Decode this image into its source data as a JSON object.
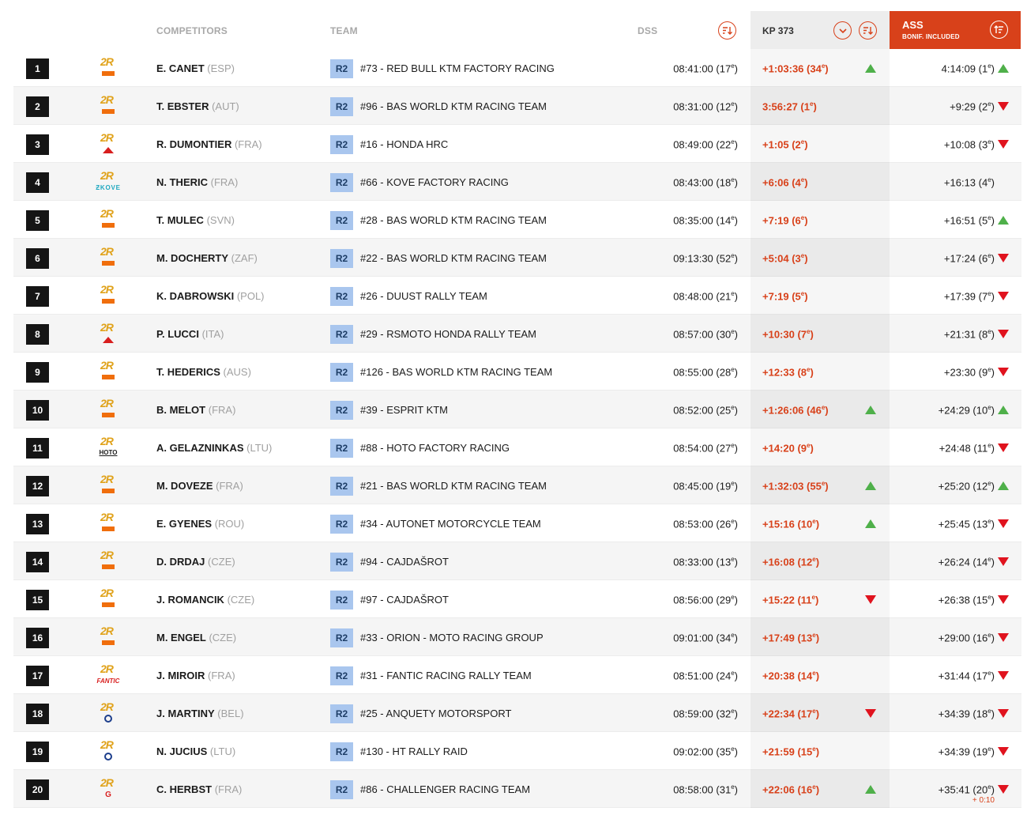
{
  "header": {
    "competitors": "COMPETITORS",
    "team": "TEAM",
    "dss": "DSS",
    "kp": "KP 373",
    "ass": "ASS",
    "ass_sub": "BONIF. INCLUDED"
  },
  "logo_text": "2R",
  "colors": {
    "accent": "#d8411a",
    "up": "#4fb04a",
    "down": "#e0131e",
    "category": "#a9c6ee"
  },
  "rows": [
    {
      "pos": "1",
      "brand": "ktm",
      "name": "E. CANET",
      "nat": "(ESP)",
      "cat": "R2",
      "team": "#73 - RED BULL KTM FACTORY RACING",
      "dss": "08:41:00 (17",
      "dss_rank": "e",
      "dss_end": ")",
      "kp": "+1:03:36 (34",
      "kp_rank": "e",
      "kp_end": ")",
      "kp_trend": "up",
      "ass": "4:14:09 (1",
      "ass_rank": "e",
      "ass_end": ")",
      "ass_trend": "up"
    },
    {
      "pos": "2",
      "brand": "ktm",
      "name": "T. EBSTER",
      "nat": "(AUT)",
      "cat": "R2",
      "team": "#96 - BAS WORLD KTM RACING TEAM",
      "dss": "08:31:00 (12",
      "dss_rank": "e",
      "dss_end": ")",
      "kp": "3:56:27 (1",
      "kp_rank": "e",
      "kp_end": ")",
      "kp_trend": "",
      "ass": "+9:29 (2",
      "ass_rank": "e",
      "ass_end": ")",
      "ass_trend": "down"
    },
    {
      "pos": "3",
      "brand": "honda",
      "name": "R. DUMONTIER",
      "nat": "(FRA)",
      "cat": "R2",
      "team": "#16 - HONDA HRC",
      "dss": "08:49:00 (22",
      "dss_rank": "e",
      "dss_end": ")",
      "kp": "+1:05 (2",
      "kp_rank": "e",
      "kp_end": ")",
      "kp_trend": "",
      "ass": "+10:08 (3",
      "ass_rank": "e",
      "ass_end": ")",
      "ass_trend": "down"
    },
    {
      "pos": "4",
      "brand": "kove",
      "name": "N. THERIC",
      "nat": "(FRA)",
      "cat": "R2",
      "team": "#66 - KOVE FACTORY RACING",
      "dss": "08:43:00 (18",
      "dss_rank": "e",
      "dss_end": ")",
      "kp": "+6:06 (4",
      "kp_rank": "e",
      "kp_end": ")",
      "kp_trend": "",
      "ass": "+16:13 (4",
      "ass_rank": "e",
      "ass_end": ")",
      "ass_trend": ""
    },
    {
      "pos": "5",
      "brand": "ktm",
      "name": "T. MULEC",
      "nat": "(SVN)",
      "cat": "R2",
      "team": "#28 - BAS WORLD KTM RACING TEAM",
      "dss": "08:35:00 (14",
      "dss_rank": "e",
      "dss_end": ")",
      "kp": "+7:19 (6",
      "kp_rank": "e",
      "kp_end": ")",
      "kp_trend": "",
      "ass": "+16:51 (5",
      "ass_rank": "e",
      "ass_end": ")",
      "ass_trend": "up"
    },
    {
      "pos": "6",
      "brand": "ktm",
      "name": "M. DOCHERTY",
      "nat": "(ZAF)",
      "cat": "R2",
      "team": "#22 - BAS WORLD KTM RACING TEAM",
      "dss": "09:13:30 (52",
      "dss_rank": "e",
      "dss_end": ")",
      "kp": "+5:04 (3",
      "kp_rank": "e",
      "kp_end": ")",
      "kp_trend": "",
      "ass": "+17:24 (6",
      "ass_rank": "e",
      "ass_end": ")",
      "ass_trend": "down"
    },
    {
      "pos": "7",
      "brand": "ktm",
      "name": "K. DABROWSKI",
      "nat": "(POL)",
      "cat": "R2",
      "team": "#26 - DUUST RALLY TEAM",
      "dss": "08:48:00 (21",
      "dss_rank": "e",
      "dss_end": ")",
      "kp": "+7:19 (5",
      "kp_rank": "e",
      "kp_end": ")",
      "kp_trend": "",
      "ass": "+17:39 (7",
      "ass_rank": "e",
      "ass_end": ")",
      "ass_trend": "down"
    },
    {
      "pos": "8",
      "brand": "honda",
      "name": "P. LUCCI",
      "nat": "(ITA)",
      "cat": "R2",
      "team": "#29 - RSMOTO HONDA RALLY TEAM",
      "dss": "08:57:00 (30",
      "dss_rank": "e",
      "dss_end": ")",
      "kp": "+10:30 (7",
      "kp_rank": "e",
      "kp_end": ")",
      "kp_trend": "",
      "ass": "+21:31 (8",
      "ass_rank": "e",
      "ass_end": ")",
      "ass_trend": "down"
    },
    {
      "pos": "9",
      "brand": "ktm",
      "name": "T. HEDERICS",
      "nat": "(AUS)",
      "cat": "R2",
      "team": "#126 - BAS WORLD KTM RACING TEAM",
      "dss": "08:55:00 (28",
      "dss_rank": "e",
      "dss_end": ")",
      "kp": "+12:33 (8",
      "kp_rank": "e",
      "kp_end": ")",
      "kp_trend": "",
      "ass": "+23:30 (9",
      "ass_rank": "e",
      "ass_end": ")",
      "ass_trend": "down"
    },
    {
      "pos": "10",
      "brand": "ktm",
      "name": "B. MELOT",
      "nat": "(FRA)",
      "cat": "R2",
      "team": "#39 - ESPRIT KTM",
      "dss": "08:52:00 (25",
      "dss_rank": "e",
      "dss_end": ")",
      "kp": "+1:26:06 (46",
      "kp_rank": "e",
      "kp_end": ")",
      "kp_trend": "up",
      "ass": "+24:29 (10",
      "ass_rank": "e",
      "ass_end": ")",
      "ass_trend": "up"
    },
    {
      "pos": "11",
      "brand": "hoto",
      "name": "A. GELAZNINKAS",
      "nat": "(LTU)",
      "cat": "R2",
      "team": "#88 - HOTO FACTORY RACING",
      "dss": "08:54:00 (27",
      "dss_rank": "e",
      "dss_end": ")",
      "kp": "+14:20 (9",
      "kp_rank": "e",
      "kp_end": ")",
      "kp_trend": "",
      "ass": "+24:48 (11",
      "ass_rank": "e",
      "ass_end": ")",
      "ass_trend": "down"
    },
    {
      "pos": "12",
      "brand": "ktm",
      "name": "M. DOVEZE",
      "nat": "(FRA)",
      "cat": "R2",
      "team": "#21 - BAS WORLD KTM RACING TEAM",
      "dss": "08:45:00 (19",
      "dss_rank": "e",
      "dss_end": ")",
      "kp": "+1:32:03 (55",
      "kp_rank": "e",
      "kp_end": ")",
      "kp_trend": "up",
      "ass": "+25:20 (12",
      "ass_rank": "e",
      "ass_end": ")",
      "ass_trend": "up"
    },
    {
      "pos": "13",
      "brand": "ktm",
      "name": "E. GYENES",
      "nat": "(ROU)",
      "cat": "R2",
      "team": "#34 - AUTONET MOTORCYCLE TEAM",
      "dss": "08:53:00 (26",
      "dss_rank": "e",
      "dss_end": ")",
      "kp": "+15:16 (10",
      "kp_rank": "e",
      "kp_end": ")",
      "kp_trend": "up",
      "ass": "+25:45 (13",
      "ass_rank": "e",
      "ass_end": ")",
      "ass_trend": "down"
    },
    {
      "pos": "14",
      "brand": "ktm",
      "name": "D. DRDAJ",
      "nat": "(CZE)",
      "cat": "R2",
      "team": "#94 - CAJDAŠROT",
      "dss": "08:33:00 (13",
      "dss_rank": "e",
      "dss_end": ")",
      "kp": "+16:08 (12",
      "kp_rank": "e",
      "kp_end": ")",
      "kp_trend": "",
      "ass": "+26:24 (14",
      "ass_rank": "e",
      "ass_end": ")",
      "ass_trend": "down"
    },
    {
      "pos": "15",
      "brand": "ktm",
      "name": "J. ROMANCIK",
      "nat": "(CZE)",
      "cat": "R2",
      "team": "#97 - CAJDAŠROT",
      "dss": "08:56:00 (29",
      "dss_rank": "e",
      "dss_end": ")",
      "kp": "+15:22 (11",
      "kp_rank": "e",
      "kp_end": ")",
      "kp_trend": "down",
      "ass": "+26:38 (15",
      "ass_rank": "e",
      "ass_end": ")",
      "ass_trend": "down"
    },
    {
      "pos": "16",
      "brand": "ktm",
      "name": "M. ENGEL",
      "nat": "(CZE)",
      "cat": "R2",
      "team": "#33 - ORION - MOTO RACING GROUP",
      "dss": "09:01:00 (34",
      "dss_rank": "e",
      "dss_end": ")",
      "kp": "+17:49 (13",
      "kp_rank": "e",
      "kp_end": ")",
      "kp_trend": "",
      "ass": "+29:00 (16",
      "ass_rank": "e",
      "ass_end": ")",
      "ass_trend": "down"
    },
    {
      "pos": "17",
      "brand": "fantic",
      "name": "J. MIROIR",
      "nat": "(FRA)",
      "cat": "R2",
      "team": "#31 - FANTIC RACING RALLY TEAM",
      "dss": "08:51:00 (24",
      "dss_rank": "e",
      "dss_end": ")",
      "kp": "+20:38 (14",
      "kp_rank": "e",
      "kp_end": ")",
      "kp_trend": "",
      "ass": "+31:44 (17",
      "ass_rank": "e",
      "ass_end": ")",
      "ass_trend": "down"
    },
    {
      "pos": "18",
      "brand": "husq",
      "name": "J. MARTINY",
      "nat": "(BEL)",
      "cat": "R2",
      "team": "#25 - ANQUETY MOTORSPORT",
      "dss": "08:59:00 (32",
      "dss_rank": "e",
      "dss_end": ")",
      "kp": "+22:34 (17",
      "kp_rank": "e",
      "kp_end": ")",
      "kp_trend": "down",
      "ass": "+34:39 (18",
      "ass_rank": "e",
      "ass_end": ")",
      "ass_trend": "down"
    },
    {
      "pos": "19",
      "brand": "husq",
      "name": "N. JUCIUS",
      "nat": "(LTU)",
      "cat": "R2",
      "team": "#130 - HT RALLY RAID",
      "dss": "09:02:00 (35",
      "dss_rank": "e",
      "dss_end": ")",
      "kp": "+21:59 (15",
      "kp_rank": "e",
      "kp_end": ")",
      "kp_trend": "",
      "ass": "+34:39 (19",
      "ass_rank": "e",
      "ass_end": ")",
      "ass_trend": "down"
    },
    {
      "pos": "20",
      "brand": "gasgas",
      "name": "C. HERBST",
      "nat": "(FRA)",
      "cat": "R2",
      "team": "#86 - CHALLENGER RACING TEAM",
      "dss": "08:58:00 (31",
      "dss_rank": "e",
      "dss_end": ")",
      "kp": "+22:06 (16",
      "kp_rank": "e",
      "kp_end": ")",
      "kp_trend": "up",
      "ass": "+35:41 (20",
      "ass_rank": "e",
      "ass_end": ")",
      "ass_trend": "down",
      "penalty": "+ 0:10"
    }
  ]
}
